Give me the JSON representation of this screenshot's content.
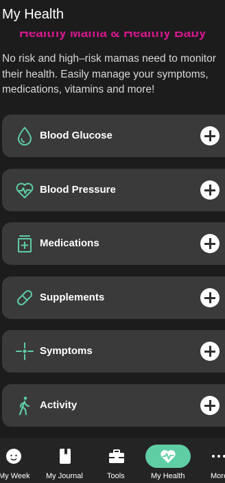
{
  "header": {
    "title": "My Health"
  },
  "intro": {
    "subtitle": "Healthy Mama & Healthy Baby",
    "description_lines": [
      "No risk and high–risk mamas need to monitor",
      "their health. Easily manage your symptoms,",
      "medications, vitamins and more!"
    ]
  },
  "cards": [
    {
      "label": "Blood Glucose",
      "icon": "drop-icon"
    },
    {
      "label": "Blood Pressure",
      "icon": "heart-pulse-icon"
    },
    {
      "label": "Medications",
      "icon": "medicine-bottle-icon"
    },
    {
      "label": "Supplements",
      "icon": "pill-capsule-icon"
    },
    {
      "label": "Symptoms",
      "icon": "crosshair-icon"
    },
    {
      "label": "Activity",
      "icon": "walking-person-icon"
    }
  ],
  "nav": {
    "items": [
      {
        "label": "My Week",
        "icon": "baby-face-icon"
      },
      {
        "label": "My Journal",
        "icon": "journal-icon"
      },
      {
        "label": "Tools",
        "icon": "toolbox-icon"
      },
      {
        "label": "My Health",
        "icon": "heart-pulse-icon",
        "active": true
      },
      {
        "label": "More",
        "icon": "more-dots-icon"
      }
    ]
  },
  "colors": {
    "accent": "#5fcea5",
    "subtitle": "#d0188a",
    "background": "#1c1c1c",
    "card": "#3a3a3a"
  }
}
